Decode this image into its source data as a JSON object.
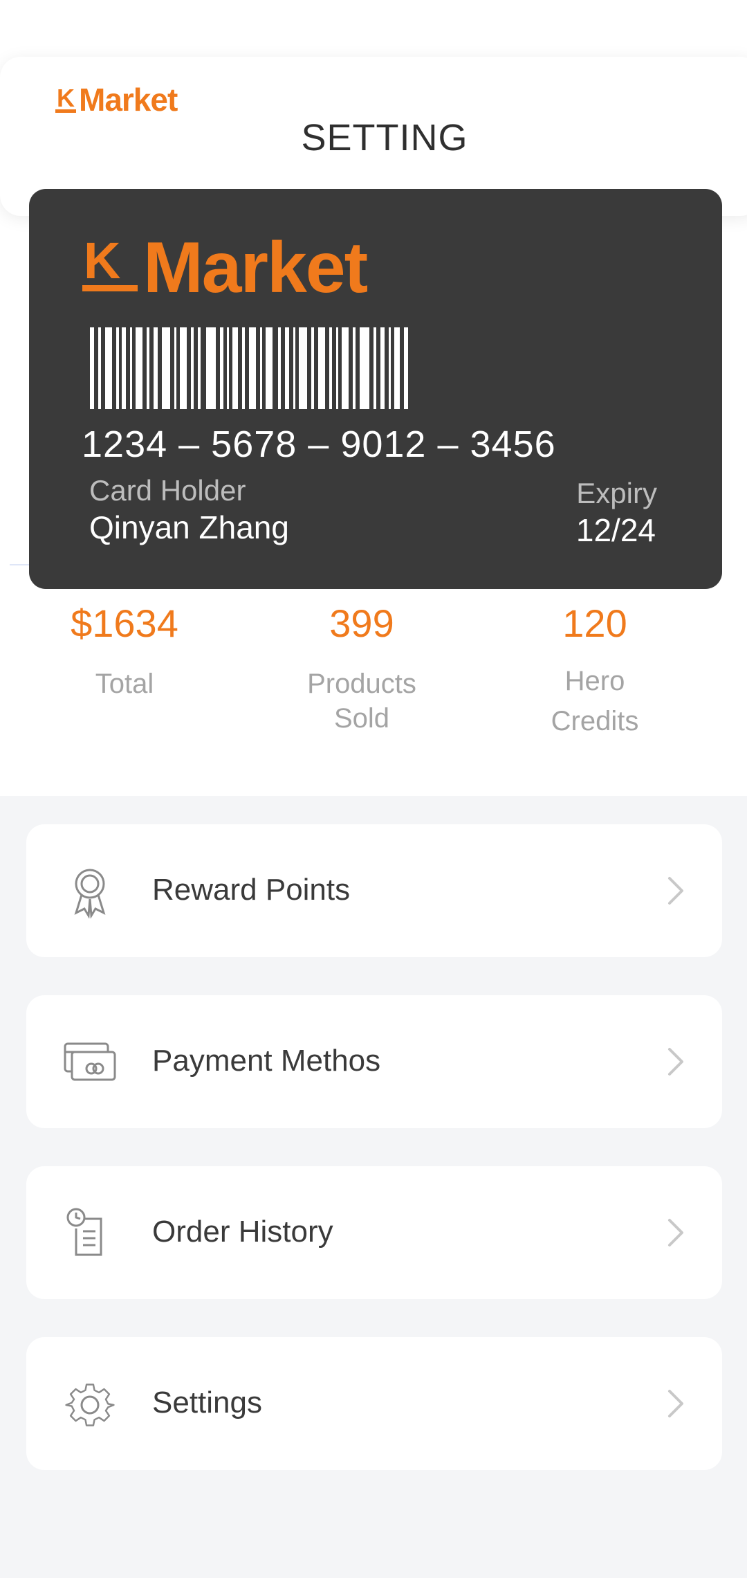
{
  "header": {
    "brand": "KMarket",
    "title": "SETTING"
  },
  "card": {
    "brand": "KMarket",
    "number": "1234 – 5678 – 9012 – 3456",
    "holder_label": "Card Holder",
    "holder_name": "Qinyan Zhang",
    "expiry_label": "Expiry",
    "expiry_value": "12/24"
  },
  "stats": [
    {
      "value": "$1634",
      "label": "Total"
    },
    {
      "value": "399",
      "label": "Products\nSold"
    },
    {
      "value": "120",
      "label": "Hero\nCredits"
    }
  ],
  "menu": [
    {
      "label": "Reward Points",
      "icon": "award-ribbon-icon"
    },
    {
      "label": "Payment Methos",
      "icon": "credit-card-icon"
    },
    {
      "label": "Order History",
      "icon": "clock-document-icon"
    },
    {
      "label": "Settings",
      "icon": "gear-icon"
    }
  ],
  "colors": {
    "brand_orange": "#f07a1c",
    "card_background": "#3a3a3a",
    "page_background": "#f4f5f7"
  }
}
